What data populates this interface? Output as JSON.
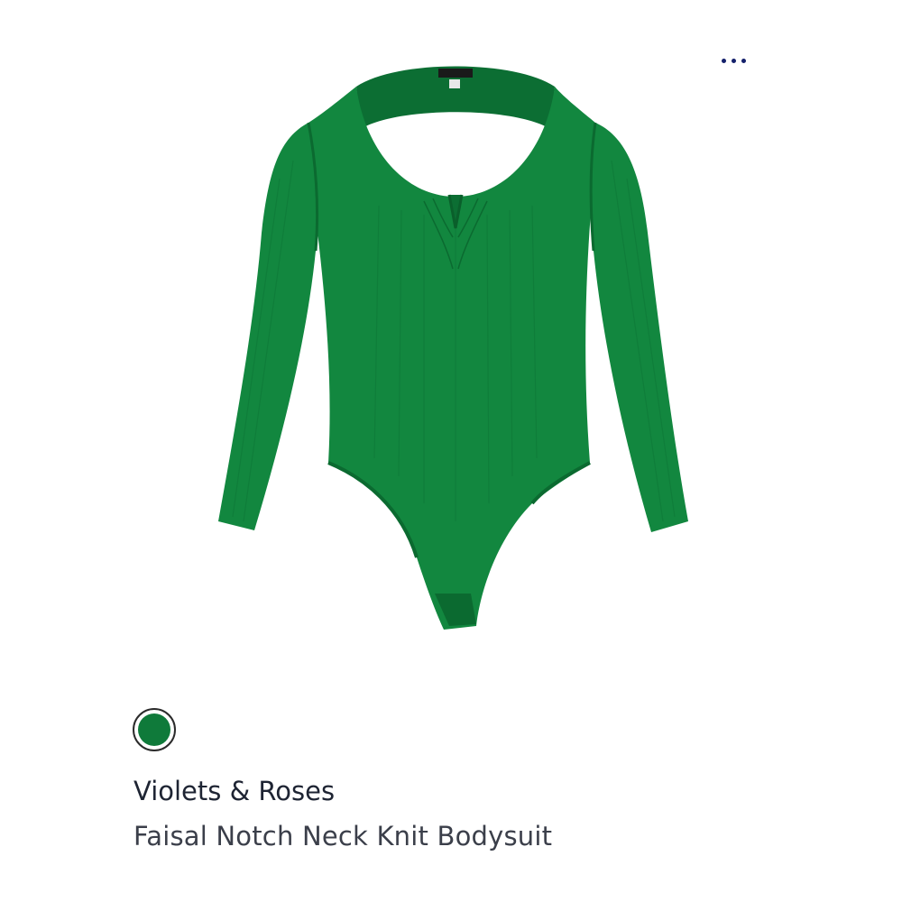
{
  "menu": {
    "icon": "more-horizontal-icon",
    "dot_color": "#14206b"
  },
  "product": {
    "image_subject": "green long-sleeve notch neck ribbed knit bodysuit",
    "garment_label": "Violets & Roses",
    "brand": "Violets & Roses",
    "name": "Faisal Notch Neck Knit Bodysuit",
    "swatches": [
      {
        "color": "#0f7a3a",
        "selected": true
      }
    ]
  },
  "colors": {
    "garment": "#12873f",
    "garment_shadow": "#0b6a30",
    "brand_text": "#1e2433",
    "name_text": "#3b3f4a"
  }
}
